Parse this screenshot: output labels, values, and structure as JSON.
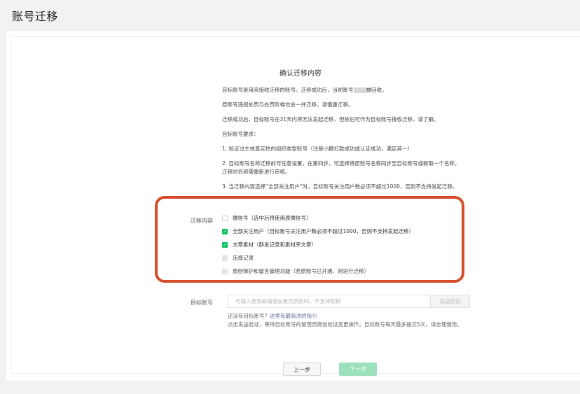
{
  "page": {
    "title": "账号迁移"
  },
  "section": {
    "title": "确认迁移内容"
  },
  "notices": [
    "目标账号是用来接收迁移的账号。迁移成功后，当前账号",
    "被回收。",
    "原账号违规处罚与处罚阶梯也会一并迁移，请慎重迁移。",
    "迁移成功后，目标账号在31天内将无法发起迁移，但依旧可作为目标账号接收迁移，请了解。",
    "目标账号要求：",
    "1. 验证过主体真实性的组织类型账号（注册小额打款成功或认证成功，满足其一）",
    "2. 目标账号名称迁移前可任意设置，在第四步，可选择将原账号名称同步至目标账号或新取一个名称，迁移时名称需重新进行审核。",
    "3. 当迁移内容选择“全部关注用户”时，目标账号关注用户数必须不超过1000，否则不支持发起迁移。"
  ],
  "migration": {
    "label": "迁移内容",
    "options": [
      {
        "text": "微信号（选中后将使用原微信号）",
        "state": "unchecked"
      },
      {
        "text": "全部关注用户（目标账号关注用户数必须不超过1000，否则不支持发起迁移）",
        "state": "checked"
      },
      {
        "text": "文章素材（群发记录和素材库文章）",
        "state": "checked"
      },
      {
        "text": "违规记录",
        "state": "disabled-checked"
      },
      {
        "text": "原创保护和留言管理功能（若原账号已开通，则进行迁移）",
        "state": "disabled-checked"
      }
    ]
  },
  "target": {
    "label": "目标账号",
    "placeholder": "可输入登录邮箱或设置页原始ID，不支持昵称",
    "send_label": "发送验证",
    "hint_prefix": "还没有目标账号？",
    "hint_link": "这里有最简洁的指引",
    "hint_body": "点击发送验证，等待目标账号的管理员微信验证变更操作。目标账号每天最多提交5次，请合理使用。"
  },
  "footer": {
    "prev_label": "上一步",
    "next_label": "下一步"
  },
  "colors": {
    "accent": "#07c160",
    "highlight": "#d64b2a",
    "link": "#576b95"
  }
}
